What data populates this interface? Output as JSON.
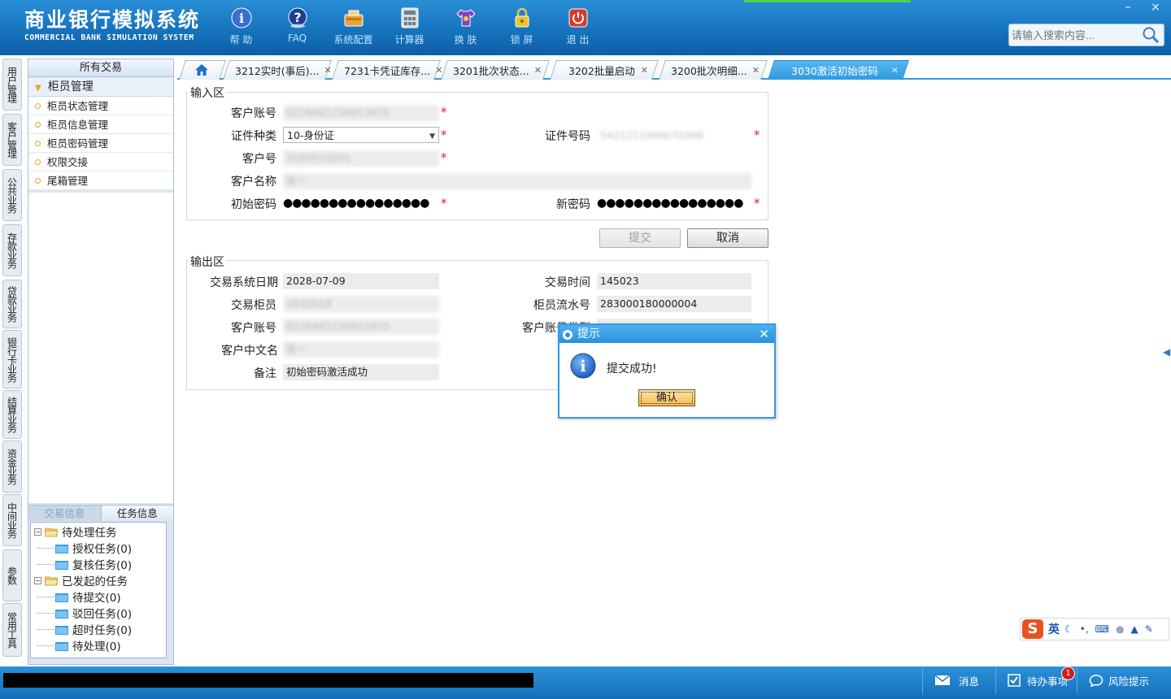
{
  "header": {
    "brand_cn": "商业银行模拟系统",
    "brand_en": "COMMERCIAL BANK SIMULATION SYSTEM",
    "toolbar": [
      {
        "label": "帮 助",
        "icon": "help-icon"
      },
      {
        "label": "FAQ",
        "icon": "faq-icon"
      },
      {
        "label": "系统配置",
        "icon": "config-icon"
      },
      {
        "label": "计算器",
        "icon": "calculator-icon"
      },
      {
        "label": "换 肤",
        "icon": "shirt-icon"
      },
      {
        "label": "锁 屏",
        "icon": "lock-icon"
      },
      {
        "label": "退 出",
        "icon": "power-icon"
      }
    ],
    "search_placeholder": "请输入搜索内容...",
    "window_controls": {
      "minimize": "–",
      "close": "×"
    }
  },
  "vertical_tabs": [
    "用户管理",
    "客户管理",
    "公共业务",
    "存款业务",
    "贷款业务",
    "银行卡业务",
    "结算业务",
    "资金业务",
    "中间业务",
    "参数",
    "常用工具"
  ],
  "left_panel": {
    "title": "所有交易",
    "group": "柜员管理",
    "items": [
      "柜员状态管理",
      "柜员信息管理",
      "柜员密码管理",
      "权限交接",
      "尾箱管理"
    ],
    "task_tabs": [
      "交易信息",
      "任务信息"
    ],
    "tree": {
      "pending": "待处理任务",
      "pending_children": [
        "授权任务(0)",
        "复核任务(0)"
      ],
      "started": "已发起的任务",
      "started_children": [
        "待提交(0)",
        "驳回任务(0)",
        "超时任务(0)",
        "待处理(0)"
      ]
    }
  },
  "tabs": [
    {
      "label": "3212实时(事后)...",
      "active": false
    },
    {
      "label": "7231卡凭证库存...",
      "active": false
    },
    {
      "label": "3201批次状态...",
      "active": false
    },
    {
      "label": "3202批量启动",
      "active": false
    },
    {
      "label": "3200批次明细...",
      "active": false
    },
    {
      "label": "3030激活初始密码",
      "active": true
    }
  ],
  "input_section": {
    "legend": "输入区",
    "account_label": "客户账号",
    "account_value": "6228461230912875",
    "id_type_label": "证件种类",
    "id_type_value": "10-身份证",
    "id_number_label": "证件号码",
    "id_number_value": "5421211999070366",
    "customer_no_label": "客户号",
    "customer_no_value": "3100523291",
    "customer_name_label": "客户名称",
    "customer_name_value": "张一",
    "init_pwd_label": "初始密码",
    "init_pwd_value": "●●●●●●●●●●●●●●●●",
    "new_pwd_label": "新密码",
    "new_pwd_value": "●●●●●●●●●●●●●●●●",
    "required_mark": "*"
  },
  "buttons": {
    "submit": "提交",
    "cancel": "取消"
  },
  "output_section": {
    "legend": "输出区",
    "txn_date_label": "交易系统日期",
    "txn_date_value": "2028-07-09",
    "txn_time_label": "交易时间",
    "txn_time_value": "145023",
    "teller_label": "交易柜员",
    "teller_value": "2830018",
    "teller_serial_label": "柜员流水号",
    "teller_serial_value": "283000180000004",
    "account_label": "客户账号",
    "account_value": "6228461230912875",
    "account_type_label": "客户账号类型",
    "account_type_value": "",
    "cn_name_label": "客户中文名",
    "cn_name_value": "张一",
    "remark_label": "备注",
    "remark_value": "初始密码激活成功"
  },
  "dialog": {
    "title": "提示",
    "message": "提交成功!",
    "ok": "确认"
  },
  "footer": {
    "messages": "消息",
    "todo": "待办事项",
    "todo_badge": "1",
    "risk": "风险提示"
  },
  "ime": {
    "mode": "英"
  },
  "colors": {
    "header": "#1673be",
    "tab_active": "#2f9be3",
    "required": "#e02020"
  }
}
